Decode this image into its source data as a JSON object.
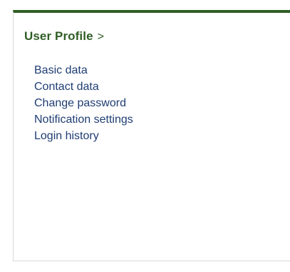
{
  "panel": {
    "title": "User Profile",
    "chevron": ">",
    "accent_color": "#2f5d24",
    "link_color": "#1f3d73"
  },
  "menu": {
    "items": [
      {
        "label": "Basic data"
      },
      {
        "label": "Contact data"
      },
      {
        "label": "Change password"
      },
      {
        "label": "Notification settings"
      },
      {
        "label": "Login history"
      }
    ]
  }
}
